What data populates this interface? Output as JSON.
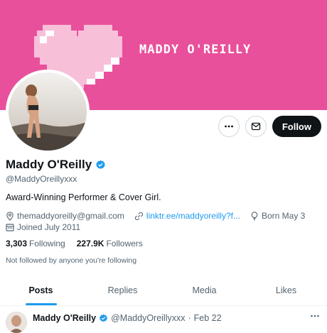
{
  "banner": {
    "text": "MADDY O'REILLY",
    "color": "#e8509b"
  },
  "profile": {
    "display_name": "Maddy O'Reilly",
    "handle": "@MaddyOreillyxxx",
    "verified": true,
    "bio": "Award-Winning Performer & Cover Girl.",
    "email": "themaddyoreilly@gmail.com",
    "link": "linktr.ee/maddyoreilly?f...",
    "birthday": "Born May 3",
    "joined": "Joined July 2011",
    "following_count": "3,303",
    "following_label": "Following",
    "followers_count": "227.9K",
    "followers_label": "Followers",
    "not_followed": "Not followed by anyone you're following"
  },
  "actions": {
    "more_icon": "more-icon",
    "message_icon": "mail-icon",
    "follow_label": "Follow"
  },
  "tabs": [
    {
      "label": "Posts",
      "active": true
    },
    {
      "label": "Replies",
      "active": false
    },
    {
      "label": "Media",
      "active": false
    },
    {
      "label": "Likes",
      "active": false
    }
  ],
  "post": {
    "name": "Maddy O'Reilly",
    "handle": "@MaddyOreillyxxx",
    "sep": "·",
    "date": "Feb 22"
  },
  "colors": {
    "accent": "#1d9bf0",
    "verified": "#1d9bf0",
    "follow_bg": "#0f1419"
  }
}
